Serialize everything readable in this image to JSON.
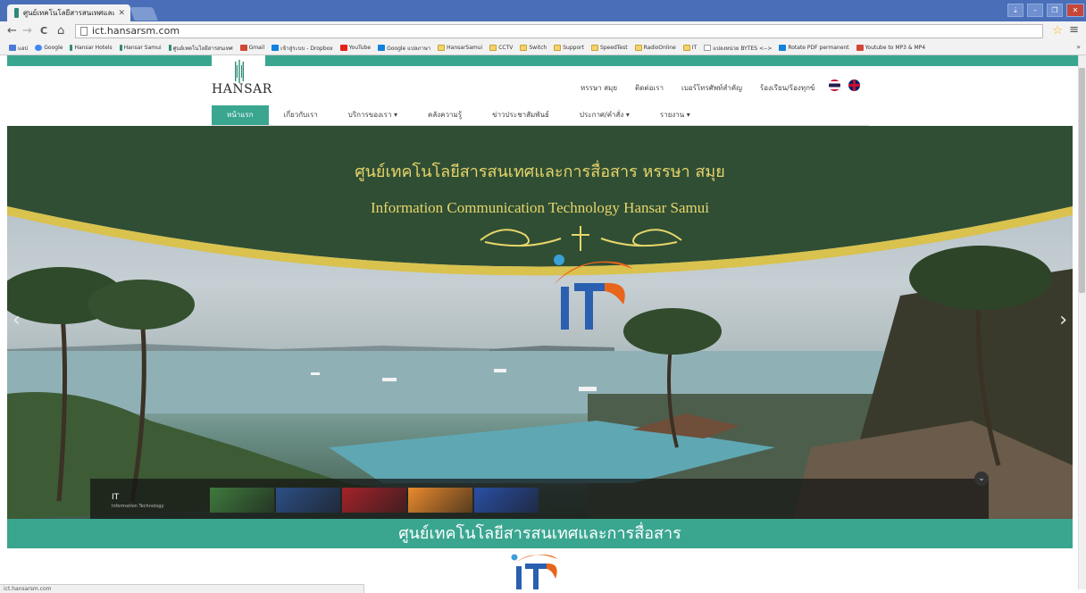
{
  "browser": {
    "tab_title": "ศูนย์เทคโนโลยีสารสนเทศและ",
    "url": "ict.hansarsm.com",
    "window_controls": [
      "⇣",
      "–",
      "❐",
      "✕"
    ],
    "nav_icons": {
      "back": "←",
      "forward": "→",
      "reload": "C",
      "home": "⌂"
    },
    "bookmarks": [
      {
        "label": "แอป",
        "icon": "grid"
      },
      {
        "label": "Google",
        "icon": "g"
      },
      {
        "label": "Hansar Hotels",
        "icon": "hs"
      },
      {
        "label": "Hansar Samui",
        "icon": "hs"
      },
      {
        "label": "ศูนย์เทคโนโลยีสารสนเทศ",
        "icon": "hs"
      },
      {
        "label": "Gmail",
        "icon": "gm"
      },
      {
        "label": "เข้าสู่ระบบ - Dropbox",
        "icon": "db"
      },
      {
        "label": "YouTube",
        "icon": "yt"
      },
      {
        "label": "Google แปลภาษา",
        "icon": "db"
      },
      {
        "label": "HansarSamui",
        "icon": "folder"
      },
      {
        "label": "CCTV",
        "icon": "folder"
      },
      {
        "label": "Switch",
        "icon": "folder"
      },
      {
        "label": "Support",
        "icon": "folder"
      },
      {
        "label": "SpeedTest",
        "icon": "folder"
      },
      {
        "label": "RadioOnline",
        "icon": "folder"
      },
      {
        "label": "IT",
        "icon": "folder"
      },
      {
        "label": "แปลงหน่วย BYTES <-->",
        "icon": "page"
      },
      {
        "label": "Rotate PDF permanent",
        "icon": "db"
      },
      {
        "label": "Youtube to MP3 & MP4",
        "icon": "gm"
      }
    ],
    "bookmarks_more": "»",
    "status_text": "ict.hansarsm.com"
  },
  "site": {
    "logo_text": "HANSAR",
    "top_links": [
      "หรรษา สมุย",
      "ติดต่อเรา",
      "เบอร์โทรศัพท์สำคัญ",
      "ร้องเรียน/ร้องทุกข์"
    ],
    "nav": [
      {
        "label": "หน้าแรก",
        "active": true
      },
      {
        "label": "เกี่ยวกับเรา",
        "active": false
      },
      {
        "label": "บริการของเรา ▾",
        "active": false
      },
      {
        "label": "คลังความรู้",
        "active": false
      },
      {
        "label": "ข่าวประชาสัมพันธ์",
        "active": false
      },
      {
        "label": "ประกาศ/คำสั่ง ▾",
        "active": false
      },
      {
        "label": "รายงาน ▾",
        "active": false
      }
    ],
    "hero": {
      "title_th": "ศูนย์เทคโนโลยีสารสนเทศและการสื่อสาร หรรษา สมุย",
      "title_en": "Information Communication Technology Hansar Samui",
      "prev": "‹",
      "next": "›",
      "thumb_label": "IT",
      "thumb_sublabel": "Information Technology",
      "collapse": "⌄",
      "thumbs": [
        "#3f7a3d",
        "#2c4f86",
        "#a3232a",
        "#e98a2c",
        "#2a4fa6"
      ]
    },
    "section_title": "ศูนย์เทคโนโลยีสารสนเทศและการสื่อสาร",
    "colors": {
      "teal": "#3aa690",
      "banner_green": "#2f4e34",
      "gold": "#d9c24e",
      "it_blue": "#2b5fb0",
      "it_orange": "#e8651c"
    }
  }
}
